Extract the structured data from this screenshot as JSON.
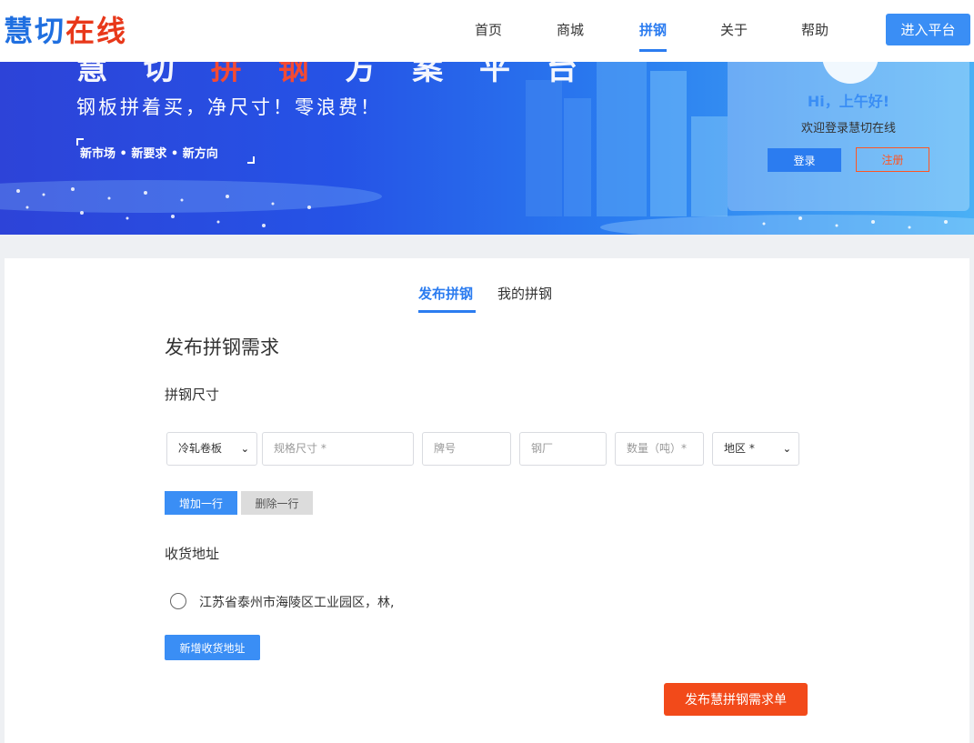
{
  "header": {
    "logo_part1": "慧切",
    "logo_part2": "在线",
    "nav": [
      {
        "label": "首页"
      },
      {
        "label": "商城"
      },
      {
        "label": "拼钢",
        "active": true
      },
      {
        "label": "关于"
      },
      {
        "label": "帮助"
      }
    ],
    "enter_label": "进入平台"
  },
  "banner": {
    "subtitle": "钢板拼着买，净尺寸！零浪费！",
    "tagline": "新市场 • 新要求 • 新方向"
  },
  "login_card": {
    "greeting": "Hi，上午好!",
    "welcome": "欢迎登录慧切在线",
    "login_label": "登录",
    "register_label": "注册"
  },
  "tabs": [
    {
      "label": "发布拼钢",
      "active": true
    },
    {
      "label": "我的拼钢",
      "active": false
    }
  ],
  "form": {
    "title": "发布拼钢需求",
    "size_section": "拼钢尺寸",
    "product_type": "冷轧卷板",
    "spec_placeholder": "规格尺寸 *",
    "grade_placeholder": "牌号",
    "mill_placeholder": "钢厂",
    "quantity_placeholder": "数量（吨）*",
    "region": "地区 *",
    "add_row_label": "增加一行",
    "delete_row_label": "删除一行",
    "address_section": "收货地址",
    "address": "江苏省泰州市海陵区工业园区，林,",
    "new_address_label": "新增收货地址",
    "submit_label": "发布慧拼钢需求单"
  },
  "colors": {
    "primary": "#3a8ef5",
    "accent_red": "#f24a1a",
    "logo_blue": "#1f6fe0",
    "logo_red": "#e8381a"
  }
}
